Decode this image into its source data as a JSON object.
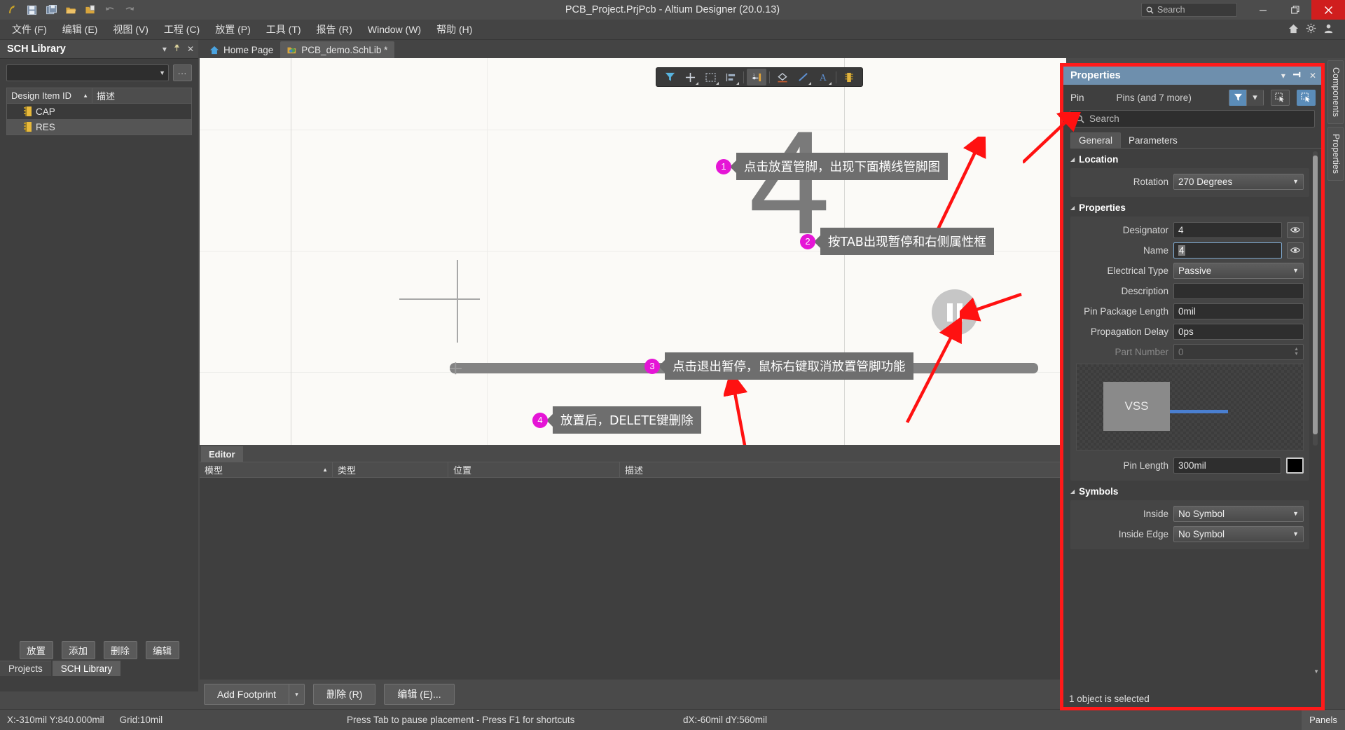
{
  "titlebar": {
    "title": "PCB_Project.PrjPcb - Altium Designer (20.0.13)",
    "search_placeholder": "Search",
    "icons": [
      "altium-logo-icon",
      "save-icon",
      "save-all-icon",
      "open-folder-icon",
      "open-project-icon",
      "undo-icon",
      "redo-icon"
    ],
    "minimize_label": "–",
    "restore_label": "❐",
    "close_label": "✕"
  },
  "menubar": {
    "items": [
      {
        "text": "文件 (F)",
        "key": "F"
      },
      {
        "text": "编辑 (E)",
        "key": "E"
      },
      {
        "text": "视图 (V)",
        "key": "V"
      },
      {
        "text": "工程 (C)",
        "key": "C"
      },
      {
        "text": "放置 (P)",
        "key": "P"
      },
      {
        "text": "工具 (T)",
        "key": "T"
      },
      {
        "text": "报告 (R)",
        "key": "R"
      },
      {
        "text": "Window (W)",
        "key": "W"
      },
      {
        "text": "帮助 (H)",
        "key": "H"
      }
    ],
    "right_icons": [
      "home-icon",
      "gear-icon",
      "user-icon"
    ]
  },
  "left_panel": {
    "title": "SCH Library",
    "header_buttons": [
      "chevron-down-icon",
      "pin-icon",
      "close-icon"
    ],
    "library_combo_value": "",
    "ellipsis_label": "...",
    "table": {
      "columns": [
        "Design Item ID",
        "描述"
      ],
      "rows": [
        {
          "id": "CAP",
          "desc": "",
          "selected": false
        },
        {
          "id": "RES",
          "desc": "",
          "selected": true
        }
      ]
    },
    "buttons": [
      "放置",
      "添加",
      "删除",
      "编辑"
    ],
    "tabs": [
      {
        "label": "Projects",
        "active": false
      },
      {
        "label": "SCH Library",
        "active": true
      }
    ]
  },
  "doc_tabs": [
    {
      "label": "Home Page",
      "active": false,
      "icon": "home-icon"
    },
    {
      "label": "PCB_demo.SchLib *",
      "active": true,
      "icon": "schlib-icon"
    }
  ],
  "float_toolbar": {
    "buttons": [
      {
        "name": "filter-icon",
        "selected": false,
        "has_dropdown": false
      },
      {
        "name": "crosshair-place-icon",
        "selected": false,
        "has_dropdown": true
      },
      {
        "name": "rectangle-select-icon",
        "selected": false,
        "has_dropdown": true
      },
      {
        "name": "align-icon",
        "selected": false,
        "has_dropdown": true
      },
      {
        "name": "place-pin-icon",
        "selected": true,
        "has_dropdown": false
      },
      {
        "name": "polygon-icon",
        "selected": false,
        "has_dropdown": false
      },
      {
        "name": "line-icon",
        "selected": false,
        "has_dropdown": true
      },
      {
        "name": "text-icon",
        "selected": false,
        "has_dropdown": true
      },
      {
        "name": "component-icon",
        "selected": false,
        "has_dropdown": false
      }
    ]
  },
  "canvas": {
    "designator_labels": [
      "4",
      "4"
    ],
    "pause_button": "pause-icon",
    "callouts": [
      {
        "num": "1",
        "text": "点击放置管脚，出现下面横线管脚图"
      },
      {
        "num": "2",
        "text": "按TAB出现暂停和右侧属性框"
      },
      {
        "num": "3",
        "text": "点击退出暂停，鼠标右键取消放置管脚功能"
      },
      {
        "num": "4",
        "text": "放置后，DELETE键删除"
      }
    ]
  },
  "editor_pane": {
    "tab_label": "Editor",
    "columns": [
      "模型",
      "类型",
      "位置",
      "描述"
    ],
    "rows": []
  },
  "bottom_toolbar": {
    "add_footprint": "Add Footprint",
    "add_footprint_caret": "▾",
    "delete": "删除 (R)",
    "edit": "编辑 (E)..."
  },
  "statusbar": {
    "coords": "X:-310mil Y:840.000mil",
    "grid": "Grid:10mil",
    "hint": "Press Tab to pause placement - Press F1 for shortcuts",
    "delta": "dX:-60mil dY:560mil",
    "panels": "Panels"
  },
  "properties": {
    "title": "Properties",
    "header_buttons": [
      "chevron-down-icon",
      "pin-icon",
      "close-icon"
    ],
    "object_label": "Pin",
    "object_value": "Pins (and 7 more)",
    "search_placeholder": "Search",
    "tabs": [
      {
        "label": "General",
        "active": true
      },
      {
        "label": "Parameters",
        "active": false
      }
    ],
    "sections": {
      "location": {
        "title": "Location",
        "rotation_label": "Rotation",
        "rotation_value": "270 Degrees"
      },
      "properties": {
        "title": "Properties",
        "designator_label": "Designator",
        "designator_value": "4",
        "name_label": "Name",
        "name_value": "4",
        "electrical_type_label": "Electrical Type",
        "electrical_type_value": "Passive",
        "description_label": "Description",
        "description_value": "",
        "pin_package_length_label": "Pin Package Length",
        "pin_package_length_value": "0mil",
        "propagation_delay_label": "Propagation Delay",
        "propagation_delay_value": "0ps",
        "part_number_label": "Part Number",
        "part_number_value": "0",
        "preview_label": "VSS",
        "pin_length_label": "Pin Length",
        "pin_length_value": "300mil",
        "pin_color": "#000000"
      },
      "symbols": {
        "title": "Symbols",
        "inside_label": "Inside",
        "inside_value": "No Symbol",
        "inside_edge_label": "Inside Edge",
        "inside_edge_value": "No Symbol"
      }
    },
    "status": "1 object is selected",
    "accent_color": "#6e8fad",
    "highlight_color": "#ff1a1a"
  },
  "vertical_tabs": [
    {
      "label": "Components"
    },
    {
      "label": "Properties"
    }
  ]
}
